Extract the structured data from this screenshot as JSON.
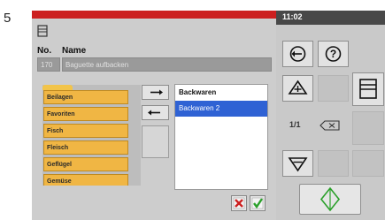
{
  "figure_number": "5",
  "status": {
    "time": "11:02"
  },
  "header": {
    "no_label": "No.",
    "name_label": "Name",
    "no_value": "170",
    "name_value": "Baguette aufbacken"
  },
  "categories": [
    "Beilagen",
    "Favoriten",
    "Fisch",
    "Fleisch",
    "Geflügel",
    "Gemüse"
  ],
  "groups": [
    {
      "label": "Backwaren",
      "selected": false
    },
    {
      "label": "Backwaren 2",
      "selected": true
    }
  ],
  "pager": {
    "page": "1/1"
  },
  "icons": {
    "doc": "document-icon",
    "move_right": "arrow-right-icon",
    "move_left": "arrow-left-icon",
    "back": "back-arrow-icon",
    "help": "question-icon",
    "up": "up-arrow-icon",
    "card": "card-icon",
    "clear": "clear-icon",
    "down": "down-arrow-icon",
    "go": "diamond-start-icon",
    "cancel": "cancel-x-icon",
    "confirm": "checkmark-icon"
  },
  "colors": {
    "top_bar_red": "#cc1f1f",
    "status_bar": "#484848",
    "category_orange": "#f0b644",
    "selection_blue": "#2f62d4",
    "cancel_red": "#cc1f1f",
    "confirm_green": "#2aa02a"
  }
}
